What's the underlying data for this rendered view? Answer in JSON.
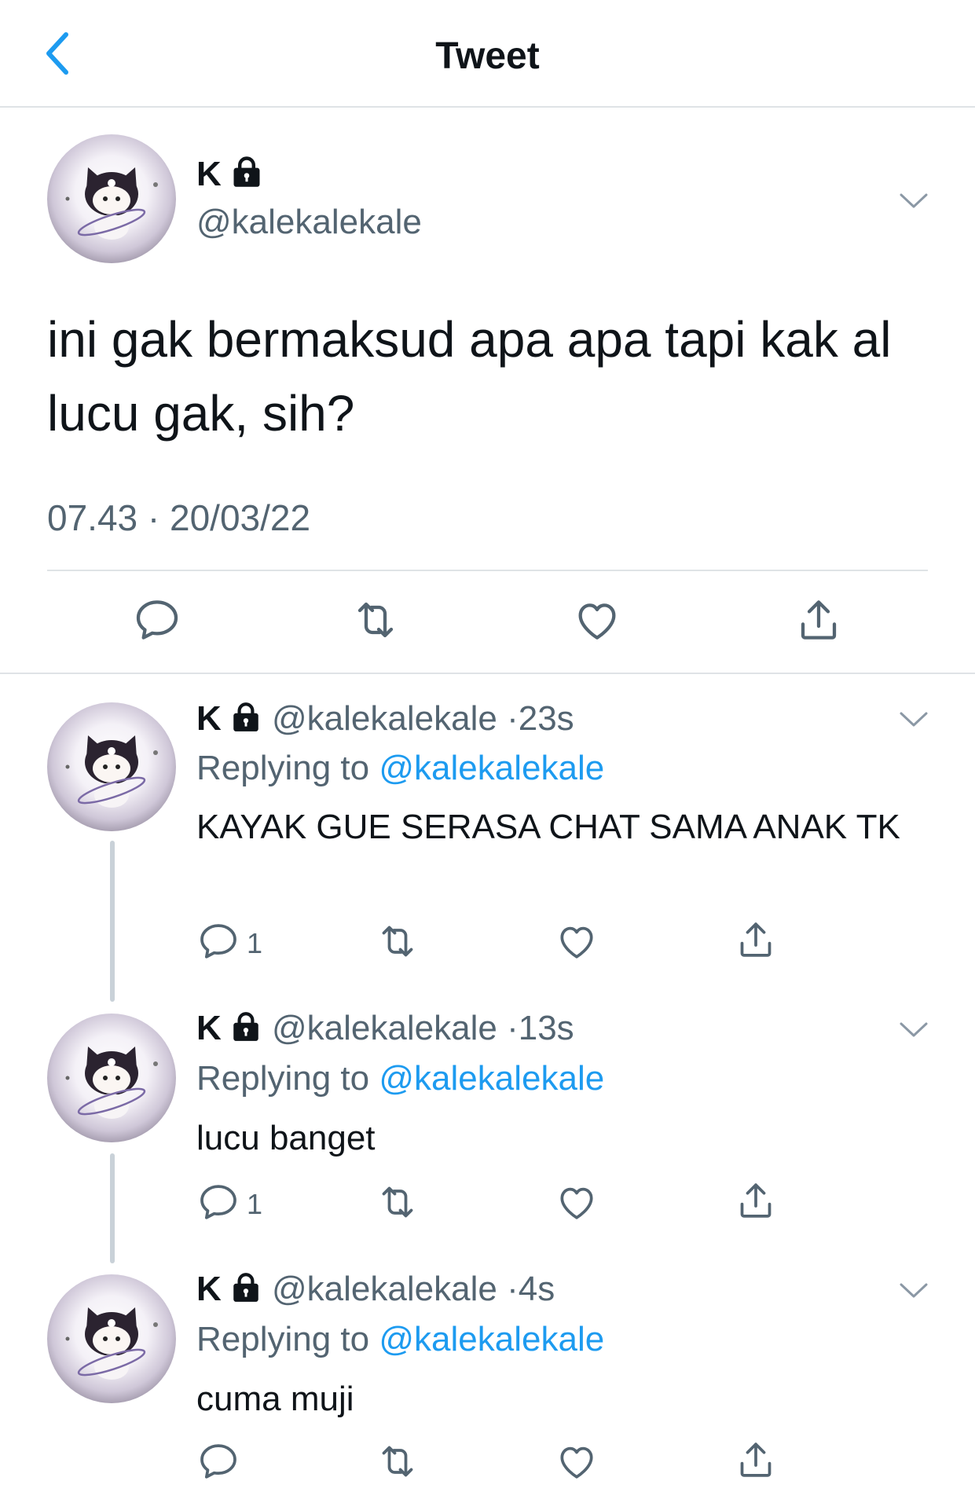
{
  "nav": {
    "title": "Tweet"
  },
  "tweet": {
    "name": "K",
    "handle": "@kalekalekale",
    "text": "ini gak bermaksud apa apa tapi kak al lucu gak, sih?",
    "time": "07.43",
    "separator": "·",
    "date": "20/03/22"
  },
  "replies": [
    {
      "name": "K",
      "handle": "@kalekalekale",
      "dot": "·",
      "age": "23s",
      "replying_label": "Replying to",
      "replying_to": "@kalekalekale",
      "text": "KAYAK GUE SERASA CHAT SAMA ANAK TK",
      "reply_count": "1"
    },
    {
      "name": "K",
      "handle": "@kalekalekale",
      "dot": "·",
      "age": "13s",
      "replying_label": "Replying to",
      "replying_to": "@kalekalekale",
      "text": "lucu banget",
      "reply_count": "1"
    },
    {
      "name": "K",
      "handle": "@kalekalekale",
      "dot": "·",
      "age": "4s",
      "replying_label": "Replying to",
      "replying_to": "@kalekalekale",
      "text": "cuma muji",
      "reply_count": ""
    }
  ],
  "colors": {
    "accent": "#1d9bf0",
    "secondary_text": "#536471",
    "divider": "#dfe3e6"
  },
  "icons": [
    "back-chevron-icon",
    "lock-icon",
    "chevron-down-icon",
    "reply-icon",
    "retweet-icon",
    "like-icon",
    "share-icon"
  ]
}
